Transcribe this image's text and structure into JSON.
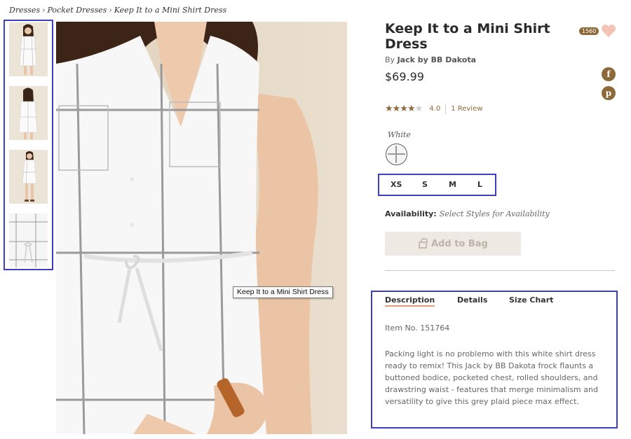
{
  "breadcrumb": {
    "items": [
      "Dresses",
      "Pocket Dresses",
      "Keep It to a Mini Shirt Dress"
    ],
    "separator": "›"
  },
  "gallery": {
    "thumbnails": [
      "thumbnail-front",
      "thumbnail-back",
      "thumbnail-full",
      "thumbnail-detail"
    ],
    "tooltip": "Keep It to a Mini Shirt Dress"
  },
  "product": {
    "title": "Keep It to a Mini Shirt Dress",
    "by_prefix": "By",
    "brand": "Jack by BB Dakota",
    "price": "$69.99",
    "favorites_count": "1560",
    "rating": {
      "value": "4.0",
      "stars_filled": 4,
      "stars_total": 5,
      "review_link": "1 Review"
    },
    "color": {
      "label": "White"
    },
    "sizes": [
      "XS",
      "S",
      "M",
      "L"
    ],
    "availability": {
      "label": "Availability:",
      "value": "Select Styles for Availability"
    },
    "add_to_bag": "Add to Bag"
  },
  "social": {
    "facebook_glyph": "f",
    "pinterest_glyph": "p"
  },
  "description": {
    "tabs": [
      "Description",
      "Details",
      "Size Chart"
    ],
    "active_tab": "Description",
    "item_number": "Item No. 151764",
    "text": "Packing light is no problemo with this white shirt dress ready to remix! This Jack by BB Dakota frock flaunts a buttoned bodice, pocketed chest, rolled shoulders, and drawstring waist - features that merge minimalism and versatility to give this grey plaid piece max effect."
  },
  "colors": {
    "accent_brown": "#8c6a3a",
    "heart_pink": "#f3c4b3",
    "tab_underline": "#e89a78",
    "highlight_box": "#3b3fc0"
  }
}
